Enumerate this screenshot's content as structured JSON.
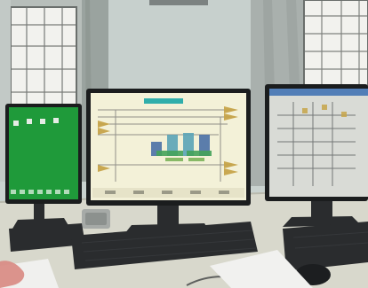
{
  "photo": {
    "colors": {
      "wall": "#c9d2cf",
      "curtain": "#9aa39f",
      "window_light": "#f2f2ee",
      "window_bars": "#6b6f6c",
      "desk": "#d8d8cc",
      "monitor_bezel": "#1b1d1e",
      "green_screen": "#1f9a3a",
      "center_screen": "#f3f1d8",
      "right_screen": "#d9dbd6",
      "keyboard": "#2a2c2e",
      "paper": "#f1f1ef",
      "skin": "#d98d86"
    },
    "icons": {
      "left_monitor": "monitor-icon",
      "center_monitor": "monitor-icon",
      "right_monitor": "monitor-icon",
      "keyboards": "keyboard-icon",
      "mouse": "mouse-icon",
      "phone": "phone-icon"
    }
  }
}
